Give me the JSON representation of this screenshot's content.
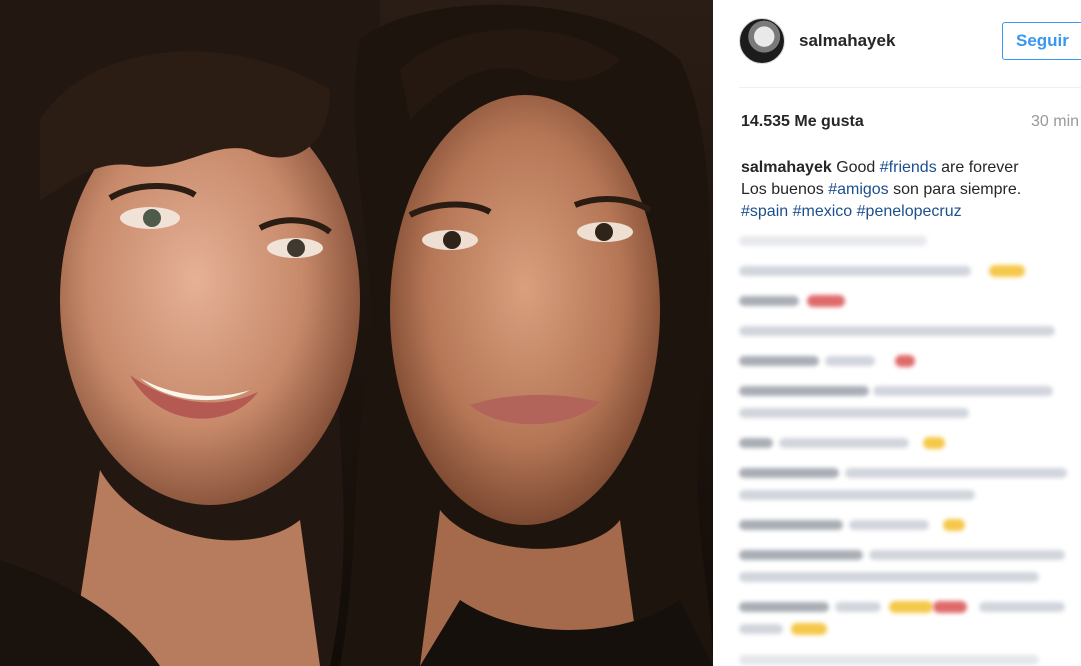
{
  "post": {
    "username": "salmahayek",
    "follow_label": "Seguir",
    "likes": "14.535 Me gusta",
    "time": "30 min",
    "caption": {
      "username": "salmahayek",
      "line1_text": "Good ",
      "line1_tag": "#friends",
      "line1_rest": " are forever",
      "line2_text": "Los buenos ",
      "line2_tag": "#amigos",
      "line2_rest": " son para siempre.",
      "tags": [
        "#spain",
        "#mexico",
        "#penelopecruz"
      ]
    }
  },
  "colors": {
    "accent": "#3897f0",
    "hashtag": "#1c4f8d",
    "muted": "#999999"
  }
}
